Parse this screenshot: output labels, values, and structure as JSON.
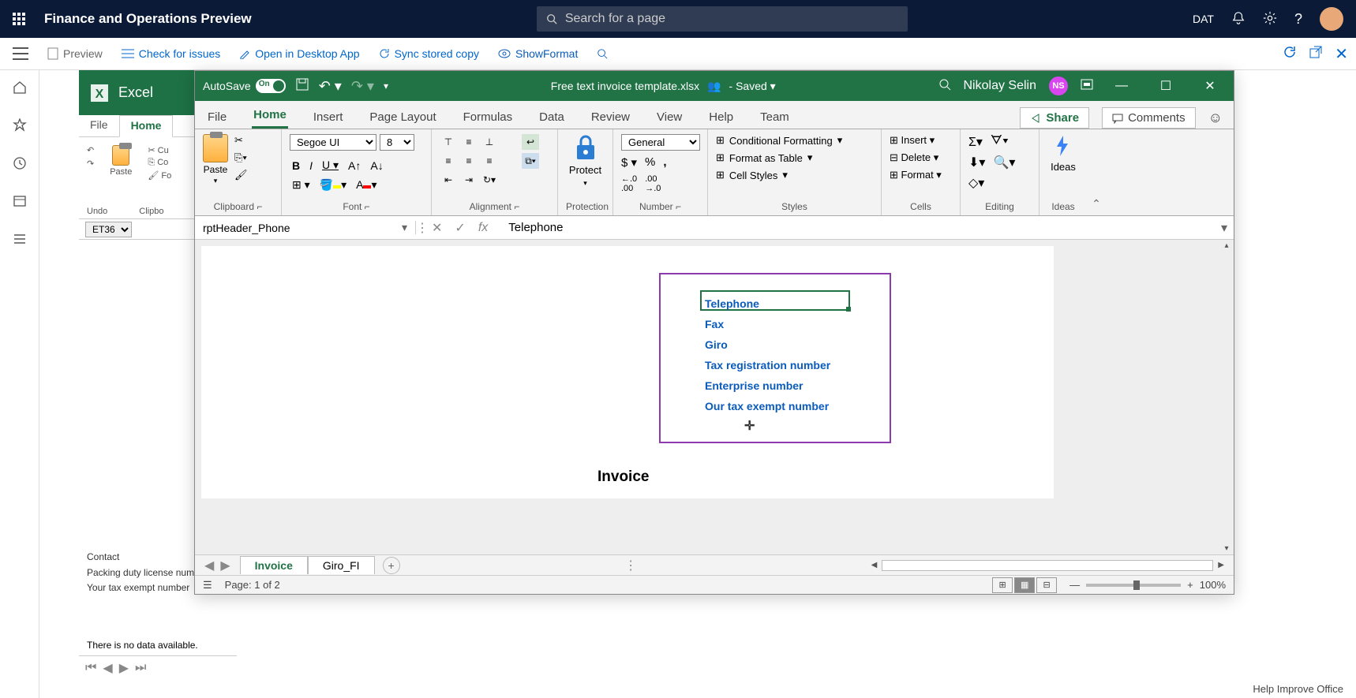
{
  "topnav": {
    "title": "Finance and Operations Preview",
    "search_placeholder": "Search for a page",
    "company": "DAT"
  },
  "subbar": {
    "preview": "Preview",
    "check": "Check for issues",
    "open_desktop": "Open in Desktop App",
    "sync": "Sync stored copy",
    "show_format": "ShowFormat"
  },
  "excel_bg": {
    "app": "Excel",
    "tab_file": "File",
    "tab_home": "Home",
    "undo_label": "Undo",
    "clipboard_label": "Clipbo",
    "cut_label": "Cu",
    "copy_label": "Co",
    "format_label": "Fo",
    "namebox_value": "ET36",
    "contact": "Contact",
    "packing": "Packing duty license number",
    "taxexempt": "Your tax exempt number",
    "nodata": "There is no data available."
  },
  "win": {
    "autosave": "AutoSave",
    "autosave_state": "On",
    "filename": "Free text invoice template.xlsx",
    "saved_state": "- Saved",
    "user_name": "Nikolay Selin",
    "user_initials": "NS"
  },
  "tabs": {
    "file": "File",
    "home": "Home",
    "insert": "Insert",
    "page_layout": "Page Layout",
    "formulas": "Formulas",
    "data": "Data",
    "review": "Review",
    "view": "View",
    "help": "Help",
    "team": "Team",
    "share": "Share",
    "comments": "Comments"
  },
  "ribbon": {
    "paste": "Paste",
    "clipboard": "Clipboard",
    "font_name": "Segoe UI",
    "font_size": "8",
    "font": "Font",
    "alignment": "Alignment",
    "protect": "Protect",
    "protection": "Protection",
    "number_format": "General",
    "number": "Number",
    "cond_format": "Conditional Formatting",
    "format_table": "Format as Table",
    "cell_styles": "Cell Styles",
    "styles": "Styles",
    "insert": "Insert",
    "delete": "Delete",
    "format": "Format",
    "cells": "Cells",
    "editing": "Editing",
    "ideas": "Ideas"
  },
  "formula": {
    "namebox": "rptHeader_Phone",
    "value": "Telephone"
  },
  "cells": [
    "Telephone",
    "Fax",
    "Giro",
    "Tax registration number",
    "Enterprise number",
    "Our tax exempt number"
  ],
  "sheet": {
    "invoice": "Invoice"
  },
  "sheet_tabs": {
    "tab1": "Invoice",
    "tab2": "Giro_FI"
  },
  "status": {
    "page": "Page: 1 of 2",
    "zoom": "100%"
  },
  "footer": {
    "help": "Help Improve Office"
  }
}
